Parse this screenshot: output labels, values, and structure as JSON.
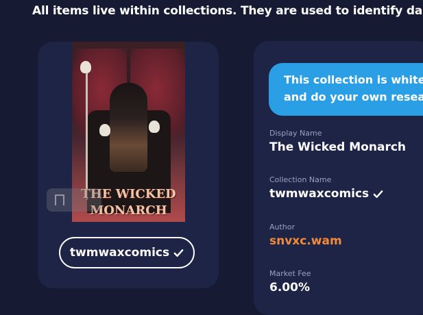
{
  "intro_text": "All items live within collections. They are used to identify dapps",
  "collection_card": {
    "image_title_line1": "THE WICKED",
    "image_title_line2": "MONARCH",
    "handle": "twmwaxcomics"
  },
  "notice": {
    "line1": "This collection is white",
    "line2": "and do your own resea"
  },
  "fields": [
    {
      "label": "Display Name",
      "value": "The Wicked Monarch"
    },
    {
      "label": "Collection Name",
      "value": "twmwaxcomics"
    },
    {
      "label": "Author",
      "value": "snvxc.wam"
    },
    {
      "label": "Market Fee",
      "value": "6.00%"
    }
  ],
  "colors": {
    "background": "#161a33",
    "card": "#1e2446",
    "notice": "#2a9fe6",
    "author_link": "#f28a3a"
  }
}
